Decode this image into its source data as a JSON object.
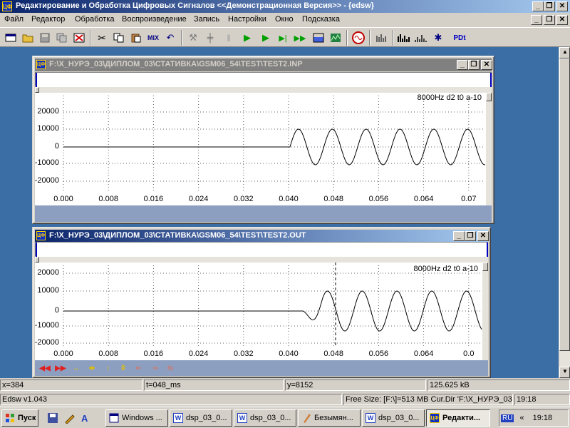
{
  "app": {
    "title": "Редактирование и Обработка Цифровых Сигналов <<Демонстрационная Версия>> - {edsw}",
    "icon_text": "ЦФ"
  },
  "window_buttons": {
    "minimize": "_",
    "restore": "❐",
    "close": "✕"
  },
  "menu": [
    "Файл",
    "Редактор",
    "Обработка",
    "Воспроизведение",
    "Запись",
    "Настройки",
    "Окно",
    "Подсказка"
  ],
  "toolbar": {
    "icons": [
      "new-icon",
      "open-icon",
      "save-icon",
      "copy-file-icon",
      "delete-icon",
      "cut-icon",
      "copy-icon",
      "paste-icon",
      "mix-icon",
      "undo-icon",
      "tool-icon",
      "mixer-icon",
      "pause-icon",
      "play-icon",
      "play-selection-icon",
      "play-to-end-icon",
      "play-from-cursor-icon",
      "select-icon",
      "spectrum-icon",
      "generator-icon",
      "equalizer-icon",
      "histogram-icon",
      "waveform-icon",
      "star-icon",
      "pd-icon"
    ],
    "mix_label": "MIX",
    "pd_label": "PDt"
  },
  "windows": [
    {
      "title": "F:\\Х_НУРЭ_03\\ДИПЛОМ_03\\СТАТИВКА\\GSM06_54\\TEST\\TEST2.INP",
      "signal_info": "8000Hz d2 t0 a-10",
      "y_ticks": [
        "20000",
        "10000",
        "0",
        "-10000",
        "-20000"
      ],
      "x_ticks": [
        "0.000",
        "0.008",
        "0.016",
        "0.024",
        "0.032",
        "0.040",
        "0.048",
        "0.056",
        "0.064",
        "0.07"
      ]
    },
    {
      "title": "F:\\Х_НУРЭ_03\\ДИПЛОМ_03\\СТАТИВКА\\GSM06_54\\TEST\\TEST2.OUT",
      "signal_info": "8000Hz d2 t0 a-10",
      "y_ticks": [
        "20000",
        "10000",
        "0",
        "-10000",
        "-20000"
      ],
      "x_ticks": [
        "0.000",
        "0.008",
        "0.016",
        "0.024",
        "0.032",
        "0.040",
        "0.048",
        "0.056",
        "0.064",
        "0.0"
      ],
      "controls": [
        "rewind-icon",
        "fast-forward-icon",
        "expand-h-icon",
        "fit-h-icon",
        "expand-v-icon",
        "fit-v-icon",
        "shift-left-icon",
        "shift-right-icon",
        "reset-icon"
      ]
    }
  ],
  "status": {
    "x": "x=384",
    "t": "t=048_ms",
    "y": "y=8152",
    "size": "125.625 kB",
    "version": "Edsw v1.043",
    "free": "Free Size: [F:\\]=513 MB Cur.Dir 'F:\\Х_НУРЭ_03\\",
    "time": "19:18"
  },
  "taskbar": {
    "start": "Пуск",
    "items": [
      "Windows ...",
      "dsp_03_0...",
      "dsp_03_0...",
      "Безымян...",
      "dsp_03_0...",
      "Редакти..."
    ],
    "lang": "RU",
    "chevron": "«",
    "clock": "19:18"
  }
}
